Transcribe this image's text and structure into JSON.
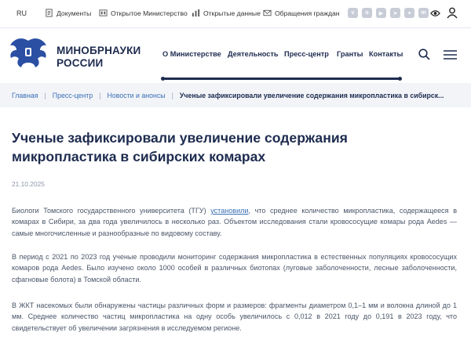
{
  "topbar": {
    "language": "RU",
    "links": [
      "Документы",
      "Открытое Министерство",
      "Открытые данные",
      "Обращения граждан"
    ]
  },
  "header": {
    "brand_line1": "МИНОБРНАУКИ",
    "brand_line2": "РОССИИ",
    "nav": [
      "О Министерстве",
      "Деятельность",
      "Пресс-центр",
      "Гранты",
      "Контакты"
    ]
  },
  "breadcrumb": [
    "Главная",
    "Пресс-центр",
    "Новости и анонсы",
    "Ученые зафиксировали увеличение содержания микропластика в сибирск..."
  ],
  "article": {
    "title": "Ученые зафиксировали увеличение содержания микропластика в сибирских комарах",
    "date": "21.10.2025",
    "p1_start": "Биологи Томского государственного университета (ТГУ) ",
    "p1_link": "установили",
    "p1_rest": ", что среднее количество микропластика, содержащееся в комарах в Сибири, за два года увеличилось в несколько раз. Объектом исследования стали кровососущие комары рода Aedes — самые многочисленные и разнообразные по видовому составу.",
    "p2": "В период с 2021 по 2023 год ученые проводили мониторинг содержания микропластика в естественных популяциях кровососущих комаров рода Aedes. Было изучено около 1000 особей в различных биотопах (луговые заболоченности, лесные заболоченности, сфагновые болота) в Томской области.",
    "p3": "В ЖКТ насекомых были обнаружены частицы различных форм и размеров: фрагменты диаметром 0,1–1 мм и волокна длиной до 1 мм. Среднее количество частиц микропластика на одну особь увеличилось с 0,012 в 2021 году до 0,191 в 2023 году, что свидетельствует об увеличении загрязнения в исследуемом регионе."
  },
  "colors": {
    "primary": "#1d2b4f",
    "link": "#3b6fb6",
    "breadcrumb_bg": "#f2f4f8"
  }
}
